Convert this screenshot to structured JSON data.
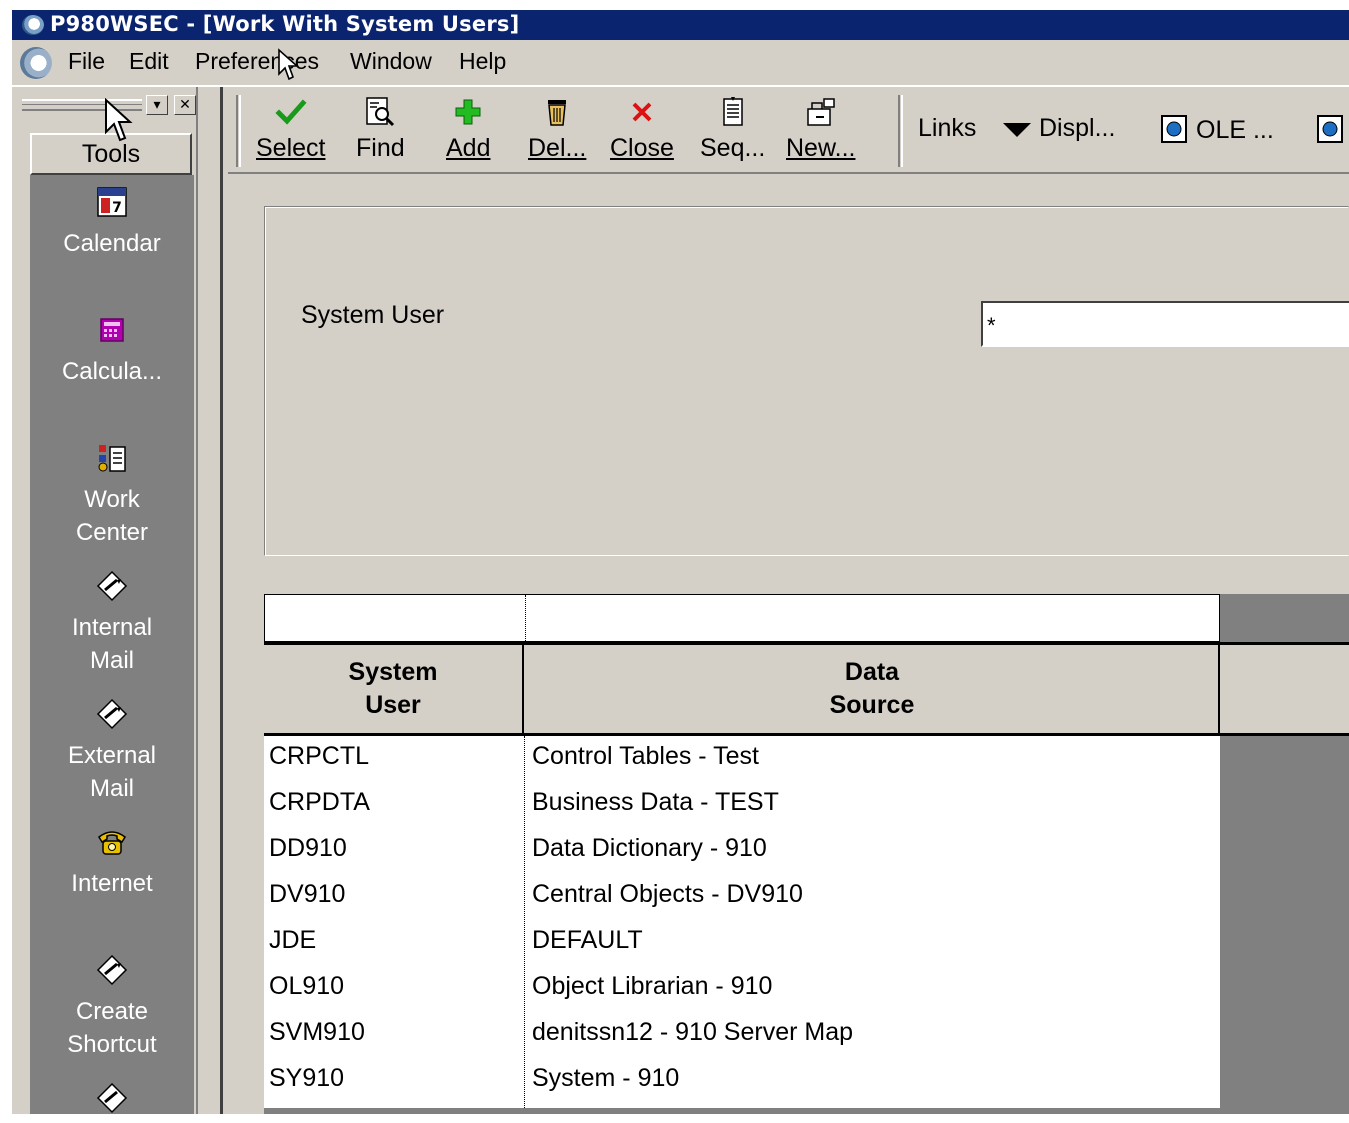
{
  "window": {
    "title": "P980WSEC - [Work With System Users]"
  },
  "menu": {
    "items": [
      {
        "id": "file",
        "label": "File"
      },
      {
        "id": "edit",
        "label": "Edit"
      },
      {
        "id": "preferences",
        "label": "Preferences"
      },
      {
        "id": "window",
        "label": "Window"
      },
      {
        "id": "help",
        "label": "Help"
      }
    ]
  },
  "tools": {
    "tab_label": "Tools",
    "items": [
      {
        "id": "calendar",
        "label": "Calendar",
        "icon": "calendar-icon"
      },
      {
        "id": "calculator",
        "label": "Calcula...",
        "icon": "calculator-icon"
      },
      {
        "id": "work-center",
        "label_line1": "Work",
        "label_line2": "Center",
        "icon": "work-center-icon"
      },
      {
        "id": "internal-mail",
        "label_line1": "Internal",
        "label_line2": "Mail",
        "icon": "mail-diamond-icon"
      },
      {
        "id": "external-mail",
        "label_line1": "External",
        "label_line2": "Mail",
        "icon": "mail-diamond-icon"
      },
      {
        "id": "internet",
        "label": "Internet",
        "icon": "telephone-icon"
      },
      {
        "id": "create-shortcut",
        "label_line1": "Create",
        "label_line2": "Shortcut",
        "icon": "shortcut-diamond-icon"
      }
    ]
  },
  "toolbar": {
    "buttons": [
      {
        "id": "select",
        "label": "Select",
        "icon": "checkmark-icon",
        "accent": "#1a9a1a"
      },
      {
        "id": "find",
        "label": "Find",
        "icon": "find-icon"
      },
      {
        "id": "add",
        "label": "Add",
        "icon": "plus-icon",
        "accent": "#22bb22"
      },
      {
        "id": "delete",
        "label": "Del...",
        "icon": "trash-icon"
      },
      {
        "id": "close",
        "label": "Close",
        "icon": "close-x-icon",
        "accent": "#dd1111"
      },
      {
        "id": "seq",
        "label": "Seq...",
        "icon": "sequence-icon"
      },
      {
        "id": "new",
        "label": "New...",
        "icon": "new-folder-icon"
      }
    ],
    "links_label": "Links",
    "display_label": "Displ...",
    "ole_label": "OLE ..."
  },
  "query": {
    "system_user_label": "System User",
    "system_user_value": "*"
  },
  "grid": {
    "columns": [
      {
        "id": "system_user",
        "line1": "System",
        "line2": "User"
      },
      {
        "id": "data_source",
        "line1": "Data",
        "line2": "Source"
      }
    ],
    "rows": [
      {
        "system_user": "CRPCTL",
        "data_source": "Control Tables - Test"
      },
      {
        "system_user": "CRPDTA",
        "data_source": "Business Data - TEST"
      },
      {
        "system_user": "DD910",
        "data_source": "Data Dictionary - 910"
      },
      {
        "system_user": "DV910",
        "data_source": "Central Objects - DV910"
      },
      {
        "system_user": "JDE",
        "data_source": "DEFAULT"
      },
      {
        "system_user": "OL910",
        "data_source": "Object Librarian - 910"
      },
      {
        "system_user": "SVM910",
        "data_source": "denitssn12 - 910 Server Map"
      },
      {
        "system_user": "SY910",
        "data_source": "System - 910"
      }
    ]
  },
  "colors": {
    "title_bar": "#0b2470",
    "chrome": "#d4d0c8",
    "tools_panel": "#808080",
    "grid_background": "#808080"
  }
}
